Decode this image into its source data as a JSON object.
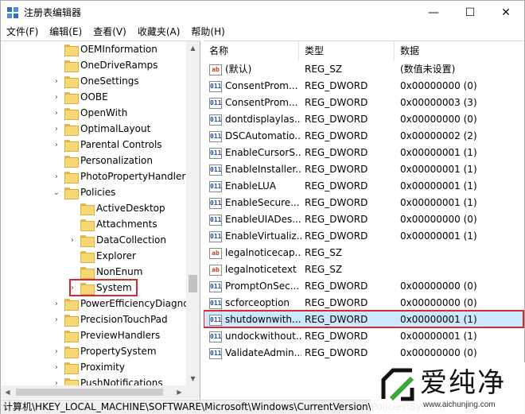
{
  "window": {
    "title": "注册表编辑器",
    "minimize_glyph": "—",
    "maximize_glyph": "☐",
    "close_glyph": "✕"
  },
  "menu": [
    {
      "label": "文件(F)"
    },
    {
      "label": "编辑(E)"
    },
    {
      "label": "查看(V)"
    },
    {
      "label": "收藏夹(A)"
    },
    {
      "label": "帮助(H)"
    }
  ],
  "tree": {
    "items": [
      {
        "label": "OEMInformation",
        "level": 1,
        "expander": ""
      },
      {
        "label": "OneDriveRamps",
        "level": 1,
        "expander": ""
      },
      {
        "label": "OneSettings",
        "level": 1,
        "expander": "›"
      },
      {
        "label": "OOBE",
        "level": 1,
        "expander": "›"
      },
      {
        "label": "OpenWith",
        "level": 1,
        "expander": "›"
      },
      {
        "label": "OptimalLayout",
        "level": 1,
        "expander": "›"
      },
      {
        "label": "Parental Controls",
        "level": 1,
        "expander": "›"
      },
      {
        "label": "Personalization",
        "level": 1,
        "expander": ""
      },
      {
        "label": "PhotoPropertyHandler",
        "level": 1,
        "expander": "›"
      },
      {
        "label": "Policies",
        "level": 1,
        "expander": "⌄"
      },
      {
        "label": "ActiveDesktop",
        "level": 2,
        "expander": ""
      },
      {
        "label": "Attachments",
        "level": 2,
        "expander": ""
      },
      {
        "label": "DataCollection",
        "level": 2,
        "expander": "›"
      },
      {
        "label": "Explorer",
        "level": 2,
        "expander": ""
      },
      {
        "label": "NonEnum",
        "level": 2,
        "expander": ""
      },
      {
        "label": "System",
        "level": 2,
        "expander": "›"
      },
      {
        "label": "PowerEfficiencyDiagno",
        "level": 1,
        "expander": "›"
      },
      {
        "label": "PrecisionTouchPad",
        "level": 1,
        "expander": "›"
      },
      {
        "label": "PreviewHandlers",
        "level": 1,
        "expander": ""
      },
      {
        "label": "PropertySystem",
        "level": 1,
        "expander": "›"
      },
      {
        "label": "Proximity",
        "level": 1,
        "expander": "›"
      },
      {
        "label": "PushNotifications",
        "level": 1,
        "expander": "›"
      }
    ]
  },
  "list": {
    "columns": {
      "name": "名称",
      "type": "类型",
      "data": "数据"
    },
    "rows": [
      {
        "name": "(默认)",
        "type": "REG_SZ",
        "data": "(数值未设置)",
        "icon": "ab"
      },
      {
        "name": "ConsentProm...",
        "type": "REG_DWORD",
        "data": "0x00000000 (0)",
        "icon": "011"
      },
      {
        "name": "ConsentProm...",
        "type": "REG_DWORD",
        "data": "0x00000003 (3)",
        "icon": "011"
      },
      {
        "name": "dontdisplaylas...",
        "type": "REG_DWORD",
        "data": "0x00000000 (0)",
        "icon": "011"
      },
      {
        "name": "DSCAutomatio...",
        "type": "REG_DWORD",
        "data": "0x00000002 (2)",
        "icon": "011"
      },
      {
        "name": "EnableCursorS...",
        "type": "REG_DWORD",
        "data": "0x00000001 (1)",
        "icon": "011"
      },
      {
        "name": "EnableInstaller...",
        "type": "REG_DWORD",
        "data": "0x00000001 (1)",
        "icon": "011"
      },
      {
        "name": "EnableLUA",
        "type": "REG_DWORD",
        "data": "0x00000001 (1)",
        "icon": "011"
      },
      {
        "name": "EnableSecure...",
        "type": "REG_DWORD",
        "data": "0x00000001 (1)",
        "icon": "011"
      },
      {
        "name": "EnableUIADes...",
        "type": "REG_DWORD",
        "data": "0x00000000 (0)",
        "icon": "011"
      },
      {
        "name": "EnableVirtualiz...",
        "type": "REG_DWORD",
        "data": "0x00000001 (1)",
        "icon": "011"
      },
      {
        "name": "legalnoticecap...",
        "type": "REG_SZ",
        "data": "",
        "icon": "ab"
      },
      {
        "name": "legalnoticetext",
        "type": "REG_SZ",
        "data": "",
        "icon": "ab"
      },
      {
        "name": "PromptOnSec...",
        "type": "REG_DWORD",
        "data": "0x00000000 (0)",
        "icon": "011"
      },
      {
        "name": "scforceoption",
        "type": "REG_DWORD",
        "data": "0x00000000 (0)",
        "icon": "011"
      },
      {
        "name": "shutdownwith...",
        "type": "REG_DWORD",
        "data": "0x00000001 (1)",
        "icon": "011"
      },
      {
        "name": "undockwithout...",
        "type": "REG_DWORD",
        "data": "0x00000001 (1)",
        "icon": "011"
      },
      {
        "name": "ValidateAdmin...",
        "type": "REG_DWORD",
        "data": "0x00000000 (0)",
        "icon": "011"
      }
    ]
  },
  "status": {
    "path": "计算机\\HKEY_LOCAL_MACHINE\\SOFTWARE\\Microsoft\\Windows\\CurrentVersion\\Policies\\System"
  },
  "watermark": {
    "text": "爱纯净",
    "url": "www.aichunjing.com"
  },
  "colors": {
    "highlight_border": "#d9272e",
    "selection": "#cce8ff",
    "folder": "#f8d775"
  }
}
